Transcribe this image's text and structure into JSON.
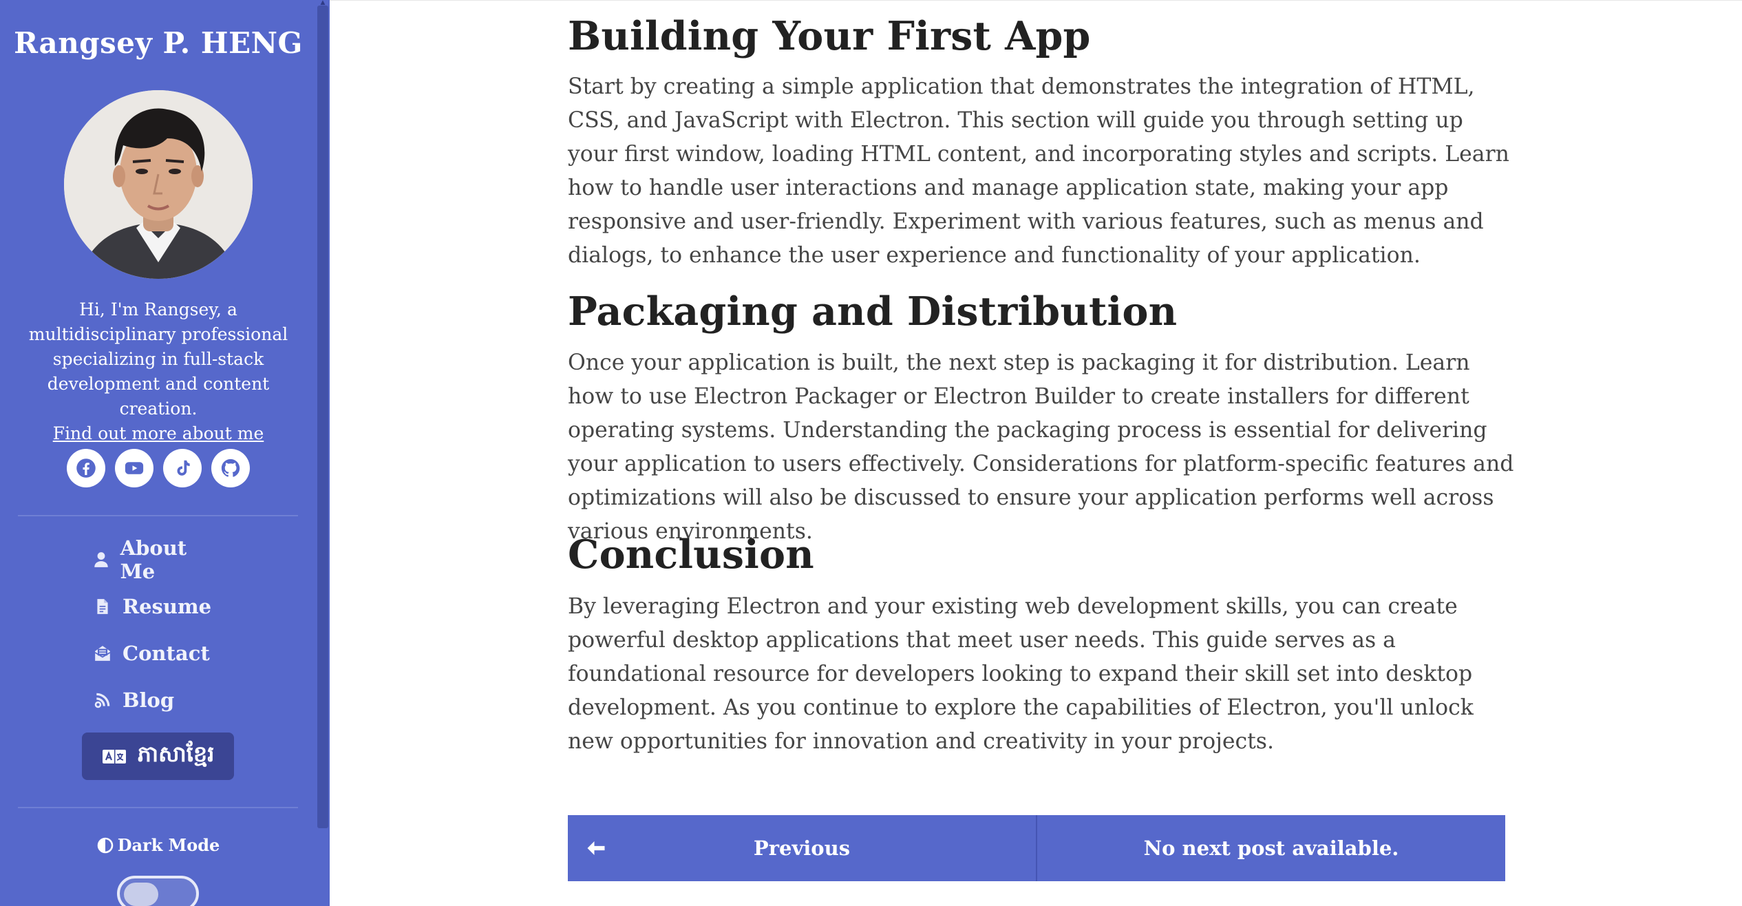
{
  "sidebar": {
    "name": "Rangsey P. HENG",
    "bio": "Hi, I'm Rangsey, a multidisciplinary professional specializing in full-stack development and content creation.",
    "bio_link": "Find out more about me",
    "nav": [
      {
        "label": "About Me",
        "icon": "user-icon"
      },
      {
        "label": "Resume",
        "icon": "file-icon"
      },
      {
        "label": "Contact",
        "icon": "envelope-open-icon"
      },
      {
        "label": "Blog",
        "icon": "blog-icon"
      }
    ],
    "language_button": "ភាសាខ្មែរ",
    "dark_mode_label": "Dark Mode",
    "dark_mode_on": false,
    "socials": [
      "facebook-icon",
      "youtube-icon",
      "tiktok-icon",
      "github-icon"
    ],
    "colors": {
      "background": "#5668cb",
      "language_button": "#3b4594"
    }
  },
  "article": {
    "sections": [
      {
        "title": "Building Your First App",
        "body": "Start by creating a simple application that demonstrates the integration of HTML, CSS, and JavaScript with Electron. This section will guide you through setting up your first window, loading HTML content, and incorporating styles and scripts. Learn how to handle user interactions and manage application state, making your app responsive and user-friendly. Experiment with various features, such as menus and dialogs, to enhance the user experience and functionality of your application."
      },
      {
        "title": "Packaging and Distribution",
        "body": "Once your application is built, the next step is packaging it for distribution. Learn how to use Electron Packager or Electron Builder to create installers for different operating systems. Understanding the packaging process is essential for delivering your application to users effectively. Considerations for platform-specific features and optimizations will also be discussed to ensure your application performs well across various environments."
      },
      {
        "title": "Conclusion",
        "body": "By leveraging Electron and your existing web development skills, you can create powerful desktop applications that meet user needs. This guide serves as a foundational resource for developers looking to expand their skill set into desktop development. As you continue to explore the capabilities of Electron, you'll unlock new opportunities for innovation and creativity in your projects."
      }
    ]
  },
  "post_nav": {
    "previous_label": "Previous",
    "next_label": "No next post available.",
    "color": "#5668cb"
  }
}
